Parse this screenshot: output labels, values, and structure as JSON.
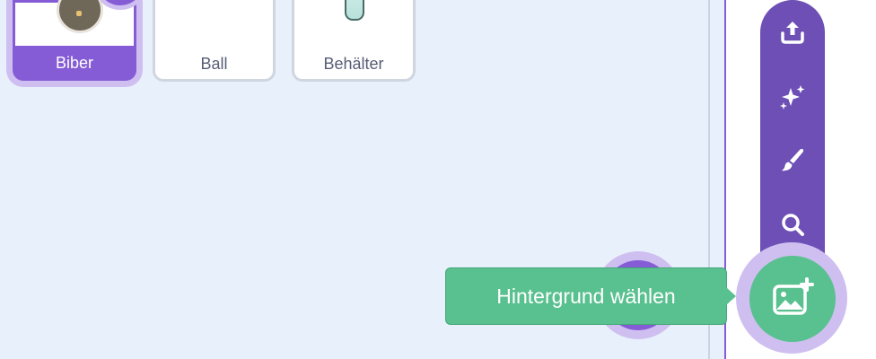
{
  "sprites": [
    {
      "label": "Biber",
      "selected": true
    },
    {
      "label": "Ball",
      "selected": false
    },
    {
      "label": "Behälter",
      "selected": false
    }
  ],
  "backdrop_menu": {
    "items": [
      {
        "icon": "upload-icon"
      },
      {
        "icon": "surprise-sparkle-icon"
      },
      {
        "icon": "paint-brush-icon"
      },
      {
        "icon": "search-icon"
      }
    ],
    "main_button_icon": "add-backdrop-image-icon",
    "tooltip": "Hintergrund wählen"
  },
  "colors": {
    "accent": "#855cd6",
    "menu": "#6d4fb6",
    "tooltip": "#59c08f",
    "background": "#e8f0fb"
  }
}
